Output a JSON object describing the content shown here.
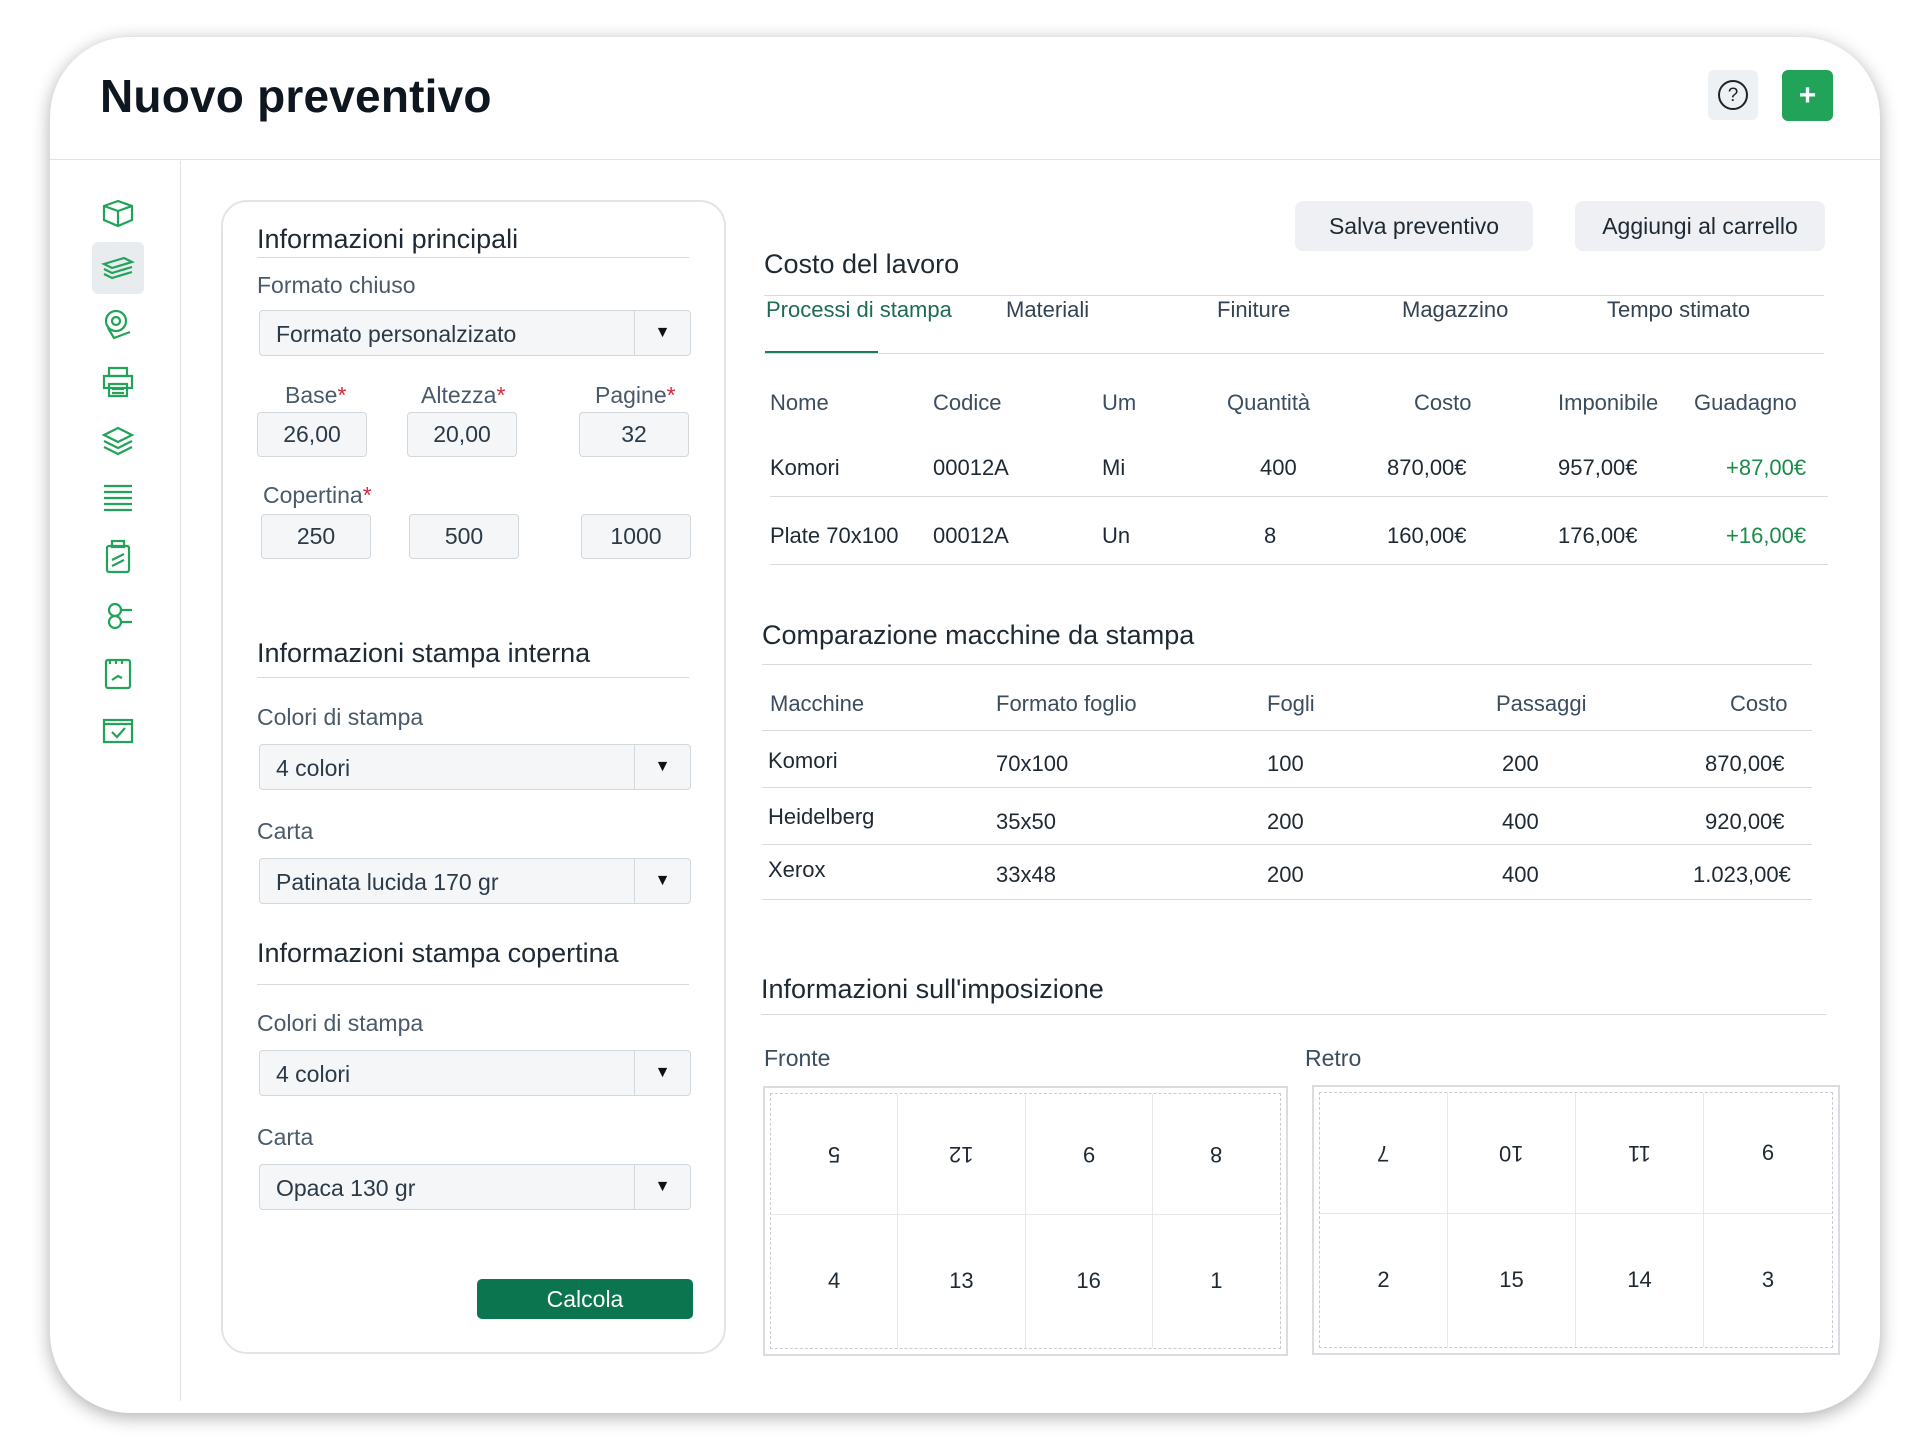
{
  "header": {
    "title": "Nuovo preventivo",
    "help_symbol": "?",
    "add_symbol": "+"
  },
  "sidebar": {
    "items": [
      {
        "icon": "box-icon",
        "active": false
      },
      {
        "icon": "paper-stack-icon",
        "active": true
      },
      {
        "icon": "paper-roll-icon",
        "active": false
      },
      {
        "icon": "printer-icon",
        "active": false
      },
      {
        "icon": "layers-icon",
        "active": false
      },
      {
        "icon": "stacked-sheets-icon",
        "active": false
      },
      {
        "icon": "binder-icon",
        "active": false
      },
      {
        "icon": "rolls-icon",
        "active": false
      },
      {
        "icon": "notebook-icon",
        "active": false
      },
      {
        "icon": "check-window-icon",
        "active": false
      }
    ]
  },
  "form": {
    "main_title": "Informazioni principali",
    "closed_format_label": "Formato chiuso",
    "closed_format_value": "Formato personalzizato",
    "base_label": "Base",
    "height_label": "Altezza",
    "pages_label": "Pagine",
    "required_mark": "*",
    "base_value": "26,00",
    "height_value": "20,00",
    "pages_value": "32",
    "cover_label": "Copertina",
    "cover_values": [
      "250",
      "500",
      "1000"
    ],
    "internal_title": "Informazioni stampa interna",
    "internal_colors_label": "Colori di stampa",
    "internal_colors_value": "4 colori",
    "internal_paper_label": "Carta",
    "internal_paper_value": "Patinata lucida 170 gr",
    "cover_title": "Informazioni stampa copertina",
    "cover_colors_label": "Colori di stampa",
    "cover_colors_value": "4 colori",
    "cover_paper_label": "Carta",
    "cover_paper_value": "Opaca 130 gr",
    "calculate_label": "Calcola"
  },
  "actions": {
    "save_label": "Salva preventivo",
    "cart_label": "Aggiungi al carrello"
  },
  "job_cost": {
    "title": "Costo del lavoro",
    "tabs": [
      "Processi di stampa",
      "Materiali",
      "Finiture",
      "Magazzino",
      "Tempo stimato"
    ],
    "columns": [
      "Nome",
      "Codice",
      "Um",
      "Quantità",
      "Costo",
      "Imponibile",
      "Guadagno"
    ],
    "rows": [
      [
        "Komori",
        "00012A",
        "Mi",
        "400",
        "870,00€",
        "957,00€",
        "+87,00€"
      ],
      [
        "Plate 70x100",
        "00012A",
        "Un",
        "8",
        "160,00€",
        "176,00€",
        "+16,00€"
      ]
    ]
  },
  "comparison": {
    "title": "Comparazione macchine da stampa",
    "columns": [
      "Macchine",
      "Formato foglio",
      "Fogli",
      "Passaggi",
      "Costo"
    ],
    "rows": [
      [
        "Komori",
        "70x100",
        "100",
        "200",
        "870,00€"
      ],
      [
        "Heidelberg",
        "35x50",
        "200",
        "400",
        "920,00€"
      ],
      [
        "Xerox",
        "33x48",
        "200",
        "400",
        "1.023,00€"
      ]
    ]
  },
  "imposition": {
    "title": "Informazioni sull'imposizione",
    "front_label": "Fronte",
    "back_label": "Retro",
    "front_top": [
      "5",
      "12",
      "9",
      "8"
    ],
    "front_bottom": [
      "4",
      "13",
      "16",
      "1"
    ],
    "back_top": [
      "7",
      "10",
      "11",
      "6"
    ],
    "back_bottom": [
      "2",
      "15",
      "14",
      "3"
    ]
  },
  "colors": {
    "brand_green": "#22a35a",
    "button_green": "#0b7550",
    "profit_green": "#1b8a4a",
    "required_red": "#d8283b"
  }
}
